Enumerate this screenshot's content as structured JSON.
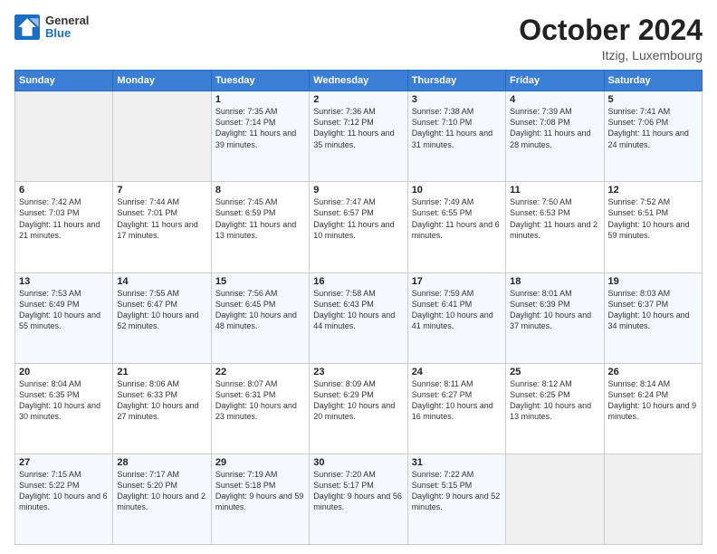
{
  "header": {
    "logo_line1": "General",
    "logo_line2": "Blue",
    "month_title": "October 2024",
    "location": "Itzig, Luxembourg"
  },
  "weekdays": [
    "Sunday",
    "Monday",
    "Tuesday",
    "Wednesday",
    "Thursday",
    "Friday",
    "Saturday"
  ],
  "weeks": [
    [
      {
        "day": "",
        "sunrise": "",
        "sunset": "",
        "daylight": ""
      },
      {
        "day": "",
        "sunrise": "",
        "sunset": "",
        "daylight": ""
      },
      {
        "day": "1",
        "sunrise": "Sunrise: 7:35 AM",
        "sunset": "Sunset: 7:14 PM",
        "daylight": "Daylight: 11 hours and 39 minutes."
      },
      {
        "day": "2",
        "sunrise": "Sunrise: 7:36 AM",
        "sunset": "Sunset: 7:12 PM",
        "daylight": "Daylight: 11 hours and 35 minutes."
      },
      {
        "day": "3",
        "sunrise": "Sunrise: 7:38 AM",
        "sunset": "Sunset: 7:10 PM",
        "daylight": "Daylight: 11 hours and 31 minutes."
      },
      {
        "day": "4",
        "sunrise": "Sunrise: 7:39 AM",
        "sunset": "Sunset: 7:08 PM",
        "daylight": "Daylight: 11 hours and 28 minutes."
      },
      {
        "day": "5",
        "sunrise": "Sunrise: 7:41 AM",
        "sunset": "Sunset: 7:06 PM",
        "daylight": "Daylight: 11 hours and 24 minutes."
      }
    ],
    [
      {
        "day": "6",
        "sunrise": "Sunrise: 7:42 AM",
        "sunset": "Sunset: 7:03 PM",
        "daylight": "Daylight: 11 hours and 21 minutes."
      },
      {
        "day": "7",
        "sunrise": "Sunrise: 7:44 AM",
        "sunset": "Sunset: 7:01 PM",
        "daylight": "Daylight: 11 hours and 17 minutes."
      },
      {
        "day": "8",
        "sunrise": "Sunrise: 7:45 AM",
        "sunset": "Sunset: 6:59 PM",
        "daylight": "Daylight: 11 hours and 13 minutes."
      },
      {
        "day": "9",
        "sunrise": "Sunrise: 7:47 AM",
        "sunset": "Sunset: 6:57 PM",
        "daylight": "Daylight: 11 hours and 10 minutes."
      },
      {
        "day": "10",
        "sunrise": "Sunrise: 7:49 AM",
        "sunset": "Sunset: 6:55 PM",
        "daylight": "Daylight: 11 hours and 6 minutes."
      },
      {
        "day": "11",
        "sunrise": "Sunrise: 7:50 AM",
        "sunset": "Sunset: 6:53 PM",
        "daylight": "Daylight: 11 hours and 2 minutes."
      },
      {
        "day": "12",
        "sunrise": "Sunrise: 7:52 AM",
        "sunset": "Sunset: 6:51 PM",
        "daylight": "Daylight: 10 hours and 59 minutes."
      }
    ],
    [
      {
        "day": "13",
        "sunrise": "Sunrise: 7:53 AM",
        "sunset": "Sunset: 6:49 PM",
        "daylight": "Daylight: 10 hours and 55 minutes."
      },
      {
        "day": "14",
        "sunrise": "Sunrise: 7:55 AM",
        "sunset": "Sunset: 6:47 PM",
        "daylight": "Daylight: 10 hours and 52 minutes."
      },
      {
        "day": "15",
        "sunrise": "Sunrise: 7:56 AM",
        "sunset": "Sunset: 6:45 PM",
        "daylight": "Daylight: 10 hours and 48 minutes."
      },
      {
        "day": "16",
        "sunrise": "Sunrise: 7:58 AM",
        "sunset": "Sunset: 6:43 PM",
        "daylight": "Daylight: 10 hours and 44 minutes."
      },
      {
        "day": "17",
        "sunrise": "Sunrise: 7:59 AM",
        "sunset": "Sunset: 6:41 PM",
        "daylight": "Daylight: 10 hours and 41 minutes."
      },
      {
        "day": "18",
        "sunrise": "Sunrise: 8:01 AM",
        "sunset": "Sunset: 6:39 PM",
        "daylight": "Daylight: 10 hours and 37 minutes."
      },
      {
        "day": "19",
        "sunrise": "Sunrise: 8:03 AM",
        "sunset": "Sunset: 6:37 PM",
        "daylight": "Daylight: 10 hours and 34 minutes."
      }
    ],
    [
      {
        "day": "20",
        "sunrise": "Sunrise: 8:04 AM",
        "sunset": "Sunset: 6:35 PM",
        "daylight": "Daylight: 10 hours and 30 minutes."
      },
      {
        "day": "21",
        "sunrise": "Sunrise: 8:06 AM",
        "sunset": "Sunset: 6:33 PM",
        "daylight": "Daylight: 10 hours and 27 minutes."
      },
      {
        "day": "22",
        "sunrise": "Sunrise: 8:07 AM",
        "sunset": "Sunset: 6:31 PM",
        "daylight": "Daylight: 10 hours and 23 minutes."
      },
      {
        "day": "23",
        "sunrise": "Sunrise: 8:09 AM",
        "sunset": "Sunset: 6:29 PM",
        "daylight": "Daylight: 10 hours and 20 minutes."
      },
      {
        "day": "24",
        "sunrise": "Sunrise: 8:11 AM",
        "sunset": "Sunset: 6:27 PM",
        "daylight": "Daylight: 10 hours and 16 minutes."
      },
      {
        "day": "25",
        "sunrise": "Sunrise: 8:12 AM",
        "sunset": "Sunset: 6:25 PM",
        "daylight": "Daylight: 10 hours and 13 minutes."
      },
      {
        "day": "26",
        "sunrise": "Sunrise: 8:14 AM",
        "sunset": "Sunset: 6:24 PM",
        "daylight": "Daylight: 10 hours and 9 minutes."
      }
    ],
    [
      {
        "day": "27",
        "sunrise": "Sunrise: 7:15 AM",
        "sunset": "Sunset: 5:22 PM",
        "daylight": "Daylight: 10 hours and 6 minutes."
      },
      {
        "day": "28",
        "sunrise": "Sunrise: 7:17 AM",
        "sunset": "Sunset: 5:20 PM",
        "daylight": "Daylight: 10 hours and 2 minutes."
      },
      {
        "day": "29",
        "sunrise": "Sunrise: 7:19 AM",
        "sunset": "Sunset: 5:18 PM",
        "daylight": "Daylight: 9 hours and 59 minutes."
      },
      {
        "day": "30",
        "sunrise": "Sunrise: 7:20 AM",
        "sunset": "Sunset: 5:17 PM",
        "daylight": "Daylight: 9 hours and 56 minutes."
      },
      {
        "day": "31",
        "sunrise": "Sunrise: 7:22 AM",
        "sunset": "Sunset: 5:15 PM",
        "daylight": "Daylight: 9 hours and 52 minutes."
      },
      {
        "day": "",
        "sunrise": "",
        "sunset": "",
        "daylight": ""
      },
      {
        "day": "",
        "sunrise": "",
        "sunset": "",
        "daylight": ""
      }
    ]
  ]
}
